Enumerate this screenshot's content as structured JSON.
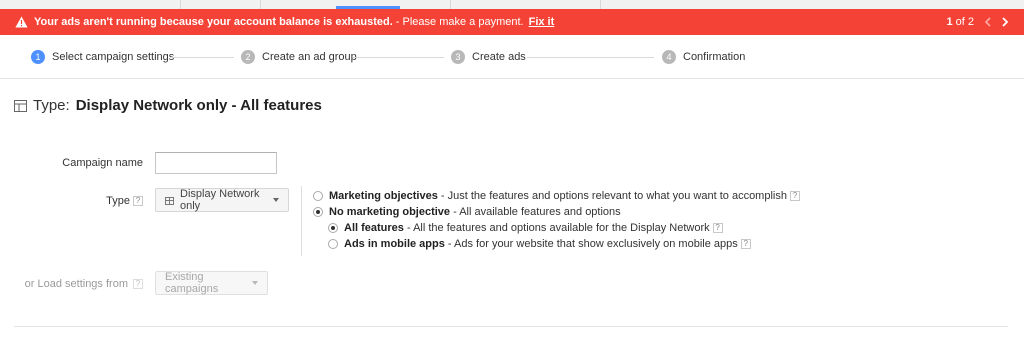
{
  "alert": {
    "message_bold": "Your ads aren't running because your account balance is exhausted.",
    "message": "- Please make a payment.",
    "fix_label": "Fix it",
    "pager_current": "1",
    "pager_rest": "of 2",
    "icons": {
      "warning": "warning-triangle-icon",
      "prev": "chevron-left-icon",
      "next": "chevron-right-icon"
    },
    "color": "#f44336"
  },
  "steps": [
    {
      "num": "1",
      "label": "Select campaign settings",
      "active": true
    },
    {
      "num": "2",
      "label": "Create an ad group",
      "active": false
    },
    {
      "num": "3",
      "label": "Create ads",
      "active": false
    },
    {
      "num": "4",
      "label": "Confirmation",
      "active": false
    }
  ],
  "title": {
    "label": "Type:",
    "value": "Display Network only - All features",
    "icon": "table-icon"
  },
  "form": {
    "campaign_name_label": "Campaign name",
    "campaign_name_value": "",
    "type_label": "Type",
    "type_dropdown": "Display Network only",
    "load_label": "or Load settings from",
    "load_dropdown": "Existing campaigns",
    "help_glyph": "?"
  },
  "options": {
    "marketing": {
      "title": "Marketing objectives",
      "desc": "- Just the features and options relevant to what you want to accomplish",
      "selected": false
    },
    "no_marketing": {
      "title": "No marketing objective",
      "desc": "- All available features and options",
      "selected": true
    },
    "all_features": {
      "title": "All features",
      "desc": "- All the features and options available for the Display Network",
      "selected": true
    },
    "mobile_apps": {
      "title": "Ads in mobile apps",
      "desc": "- Ads for your website that show exclusively on mobile apps",
      "selected": false
    }
  },
  "colors": {
    "accent": "#4d90fe",
    "step_inactive": "#b8b8b8"
  }
}
